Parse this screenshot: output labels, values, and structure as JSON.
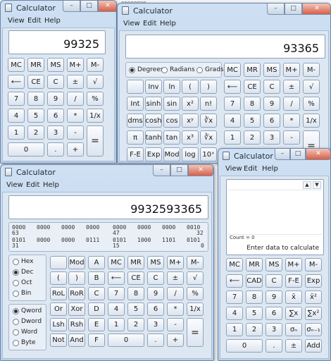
{
  "background": {
    "text": "00000000"
  },
  "windows": {
    "standard": {
      "title": "Calculator",
      "menu": [
        "View",
        "Edit",
        "Help"
      ],
      "display": "99325",
      "buttons": [
        "MC",
        "MR",
        "MS",
        "M+",
        "M-",
        "⟵",
        "CE",
        "C",
        "±",
        "√",
        "7",
        "8",
        "9",
        "/",
        "%",
        "4",
        "5",
        "6",
        "*",
        "1/x",
        "1",
        "2",
        "3",
        "-",
        "=",
        "0",
        ".",
        "+"
      ]
    },
    "scientific": {
      "title": "Calculator",
      "menu": [
        "View",
        "Edit",
        "Help"
      ],
      "display": "93365",
      "angle_modes": [
        "Degrees",
        "Radians",
        "Grads"
      ],
      "angle_selected": "Degrees",
      "sci_buttons": [
        "Inv",
        "ln",
        "(",
        ")",
        "Int",
        "sinh",
        "sin",
        "x²",
        "n!",
        "dms",
        "cosh",
        "cos",
        "xʸ",
        "∛x",
        "π",
        "tanh",
        "tan",
        "x³",
        "∛x",
        "F-E",
        "Exp",
        "Mod",
        "log",
        "10ˣ"
      ],
      "std_buttons": [
        "MC",
        "MR",
        "MS",
        "M+",
        "M-",
        "⟵",
        "CE",
        "C",
        "±",
        "√",
        "7",
        "8",
        "9",
        "/",
        "%",
        "4",
        "5",
        "6",
        "*",
        "1/x",
        "1",
        "2",
        "3",
        "-",
        "="
      ]
    },
    "programmer": {
      "title": "Calculator",
      "menu": [
        "View",
        "Edit",
        "Help"
      ],
      "display": "9932593365",
      "bits_rows": [
        [
          "0000",
          "0000",
          "0000",
          "0000",
          "0000",
          "0000",
          "0000",
          "0010"
        ],
        [
          "0101",
          "0000",
          "0000",
          "0111",
          "0101",
          "1000",
          "1101",
          "0101"
        ]
      ],
      "bits_positions": [
        [
          "63",
          "47",
          "32"
        ],
        [
          "31",
          "15",
          "0"
        ]
      ],
      "base_options": [
        "Hex",
        "Dec",
        "Oct",
        "Bin"
      ],
      "base_selected": "Dec",
      "word_options": [
        "Qword",
        "Dword",
        "Word",
        "Byte"
      ],
      "word_selected": "Qword",
      "buttons": [
        "Mod",
        "A",
        "MC",
        "MR",
        "MS",
        "M+",
        "M-",
        "(",
        ")",
        "B",
        "⟵",
        "CE",
        "C",
        "±",
        "√",
        "RoL",
        "RoR",
        "C",
        "7",
        "8",
        "9",
        "/",
        "%",
        "Or",
        "Xor",
        "D",
        "4",
        "5",
        "6",
        "*",
        "1/x",
        "Lsh",
        "Rsh",
        "E",
        "1",
        "2",
        "3",
        "-",
        "=",
        "Not",
        "And",
        "F",
        "0",
        ".",
        "+"
      ]
    },
    "statistics": {
      "title": "Calculator",
      "menu": [
        "View",
        "Edit",
        "Help"
      ],
      "count_text": "Count = 0",
      "hint": "Enter data to calculate",
      "buttons": [
        "MC",
        "MR",
        "MS",
        "M+",
        "M-",
        "⟵",
        "CAD",
        "C",
        "F-E",
        "Exp",
        "7",
        "8",
        "9",
        "x̄",
        "x̄²",
        "4",
        "5",
        "6",
        "∑x",
        "∑x²",
        "1",
        "2",
        "3",
        "σₙ",
        "σₙ₋₁",
        "0",
        ".",
        "±",
        "Add"
      ]
    }
  }
}
